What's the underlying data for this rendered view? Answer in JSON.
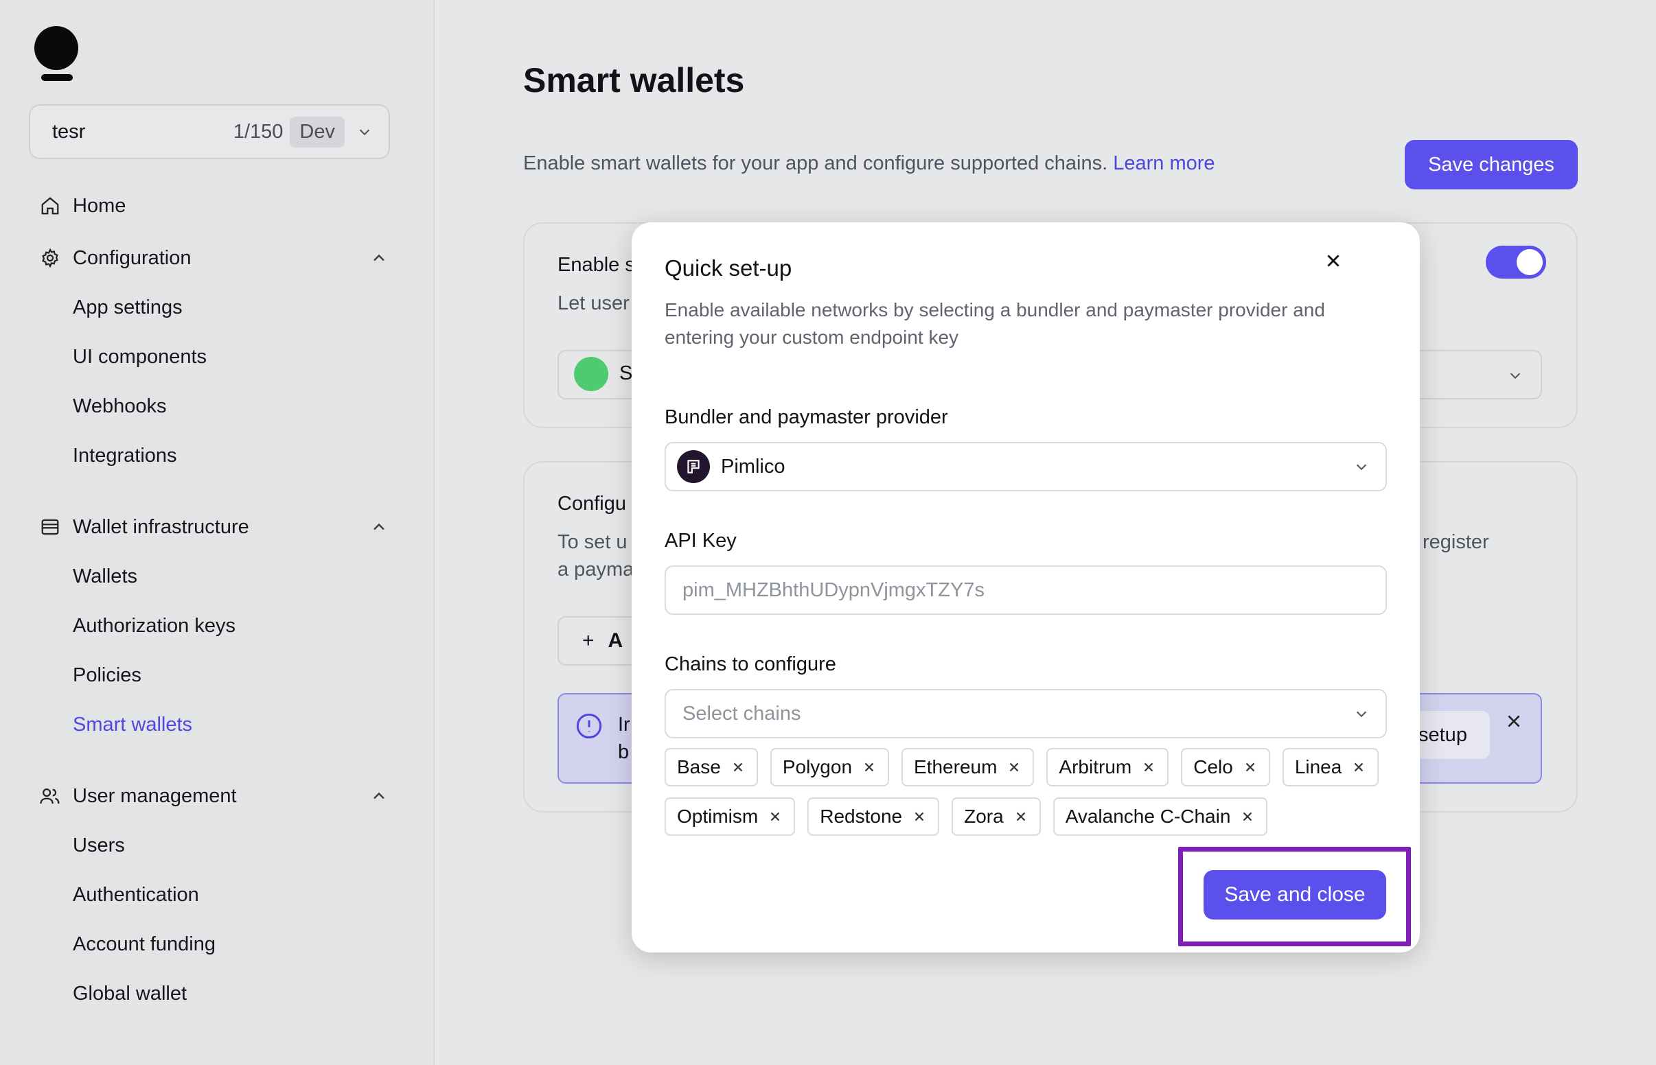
{
  "sidebar": {
    "app": {
      "name": "tesr",
      "count": "1/150",
      "env": "Dev"
    },
    "home": "Home",
    "configuration": {
      "label": "Configuration",
      "items": [
        "App settings",
        "UI components",
        "Webhooks",
        "Integrations"
      ]
    },
    "wallet_infra": {
      "label": "Wallet infrastructure",
      "items": [
        "Wallets",
        "Authorization keys",
        "Policies",
        "Smart wallets"
      ]
    },
    "user_mgmt": {
      "label": "User management",
      "items": [
        "Users",
        "Authentication",
        "Account funding",
        "Global wallet"
      ]
    },
    "active_item": "Smart wallets"
  },
  "main": {
    "title": "Smart wallets",
    "description": "Enable smart wallets for your app and configure supported chains.",
    "learn_more": "Learn more",
    "save_changes": "Save changes",
    "card1": {
      "title_partial": "Enable s",
      "desc_partial": "Let user",
      "select_partial": "S"
    },
    "card2": {
      "title_partial": "Configu",
      "desc_line1_partial": "To set u",
      "desc_line2_partial": "a payma",
      "desc_right": "register",
      "add_partial": "A",
      "banner_line1": "Ir",
      "banner_line2": "b",
      "banner_button_partial": "setup"
    }
  },
  "modal": {
    "title": "Quick set-up",
    "description": "Enable available networks by selecting a bundler and paymaster provider and entering your custom endpoint key",
    "provider_label": "Bundler and paymaster provider",
    "provider_value": "Pimlico",
    "api_key_label": "API Key",
    "api_key_placeholder": "pim_MHZBhthUDypnVjmgxTZY7s",
    "chains_label": "Chains to configure",
    "chains_placeholder": "Select chains",
    "chains": [
      "Base",
      "Polygon",
      "Ethereum",
      "Arbitrum",
      "Celo",
      "Linea",
      "Optimism",
      "Redstone",
      "Zora",
      "Avalanche C-Chain"
    ],
    "save_close": "Save and close"
  },
  "colors": {
    "accent": "#5b50eb",
    "active_link": "#5046e5",
    "highlight": "#7d1fb8"
  }
}
